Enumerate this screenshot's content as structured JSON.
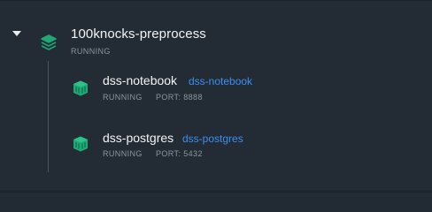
{
  "group": {
    "title": "100knocks-preprocess",
    "status": "RUNNING",
    "icon": "stack-icon",
    "expanded": true
  },
  "containers": [
    {
      "name": "dss-notebook",
      "link": "dss-notebook",
      "status": "RUNNING",
      "port": "PORT: 8888",
      "icon": "container-cube-icon"
    },
    {
      "name": "dss-postgres",
      "link": "dss-postgres",
      "status": "RUNNING",
      "port": "PORT: 5432",
      "icon": "container-cube-icon"
    }
  ],
  "colors": {
    "background": "#232c34",
    "accent_green": "#1fa774",
    "link_blue": "#3b8ff2",
    "muted_text": "#8b959e",
    "primary_text": "#f1f3f5"
  }
}
